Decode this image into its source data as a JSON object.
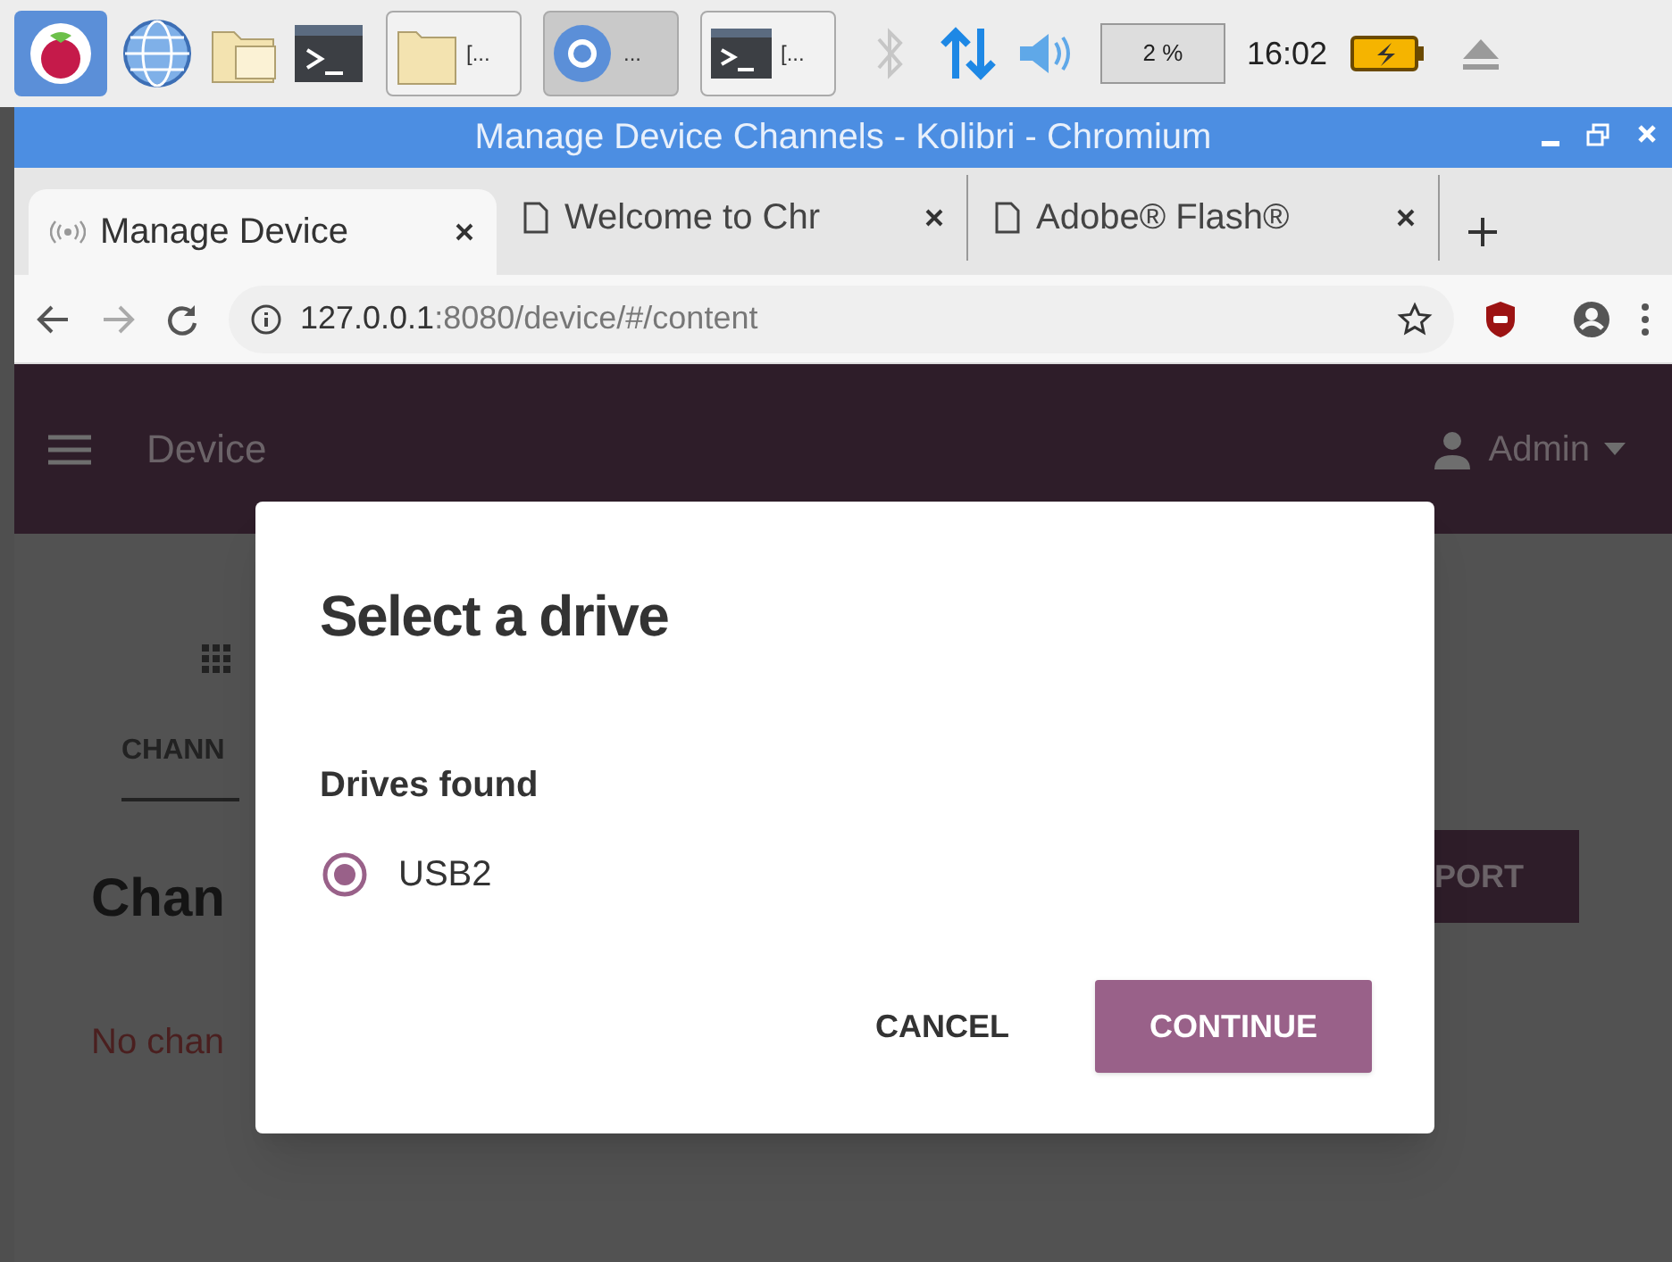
{
  "taskbar": {
    "windows": [
      {
        "kind": "folder",
        "label": "[...",
        "selected": false
      },
      {
        "kind": "browser",
        "label": "...",
        "selected": true
      },
      {
        "kind": "terminal",
        "label": "[...",
        "selected": false
      }
    ],
    "cpu": "2 %",
    "clock": "16:02"
  },
  "window": {
    "title": "Manage Device Channels - Kolibri - Chromium"
  },
  "tabs": [
    {
      "label": "Manage Device",
      "selected": true
    },
    {
      "label": "Welcome to Chr",
      "selected": false
    },
    {
      "label": "Adobe® Flash®",
      "selected": false
    }
  ],
  "address": {
    "host": "127.0.0.1",
    "path": ":8080/device/#/content"
  },
  "app": {
    "title": "Device",
    "user": "Admin",
    "tab": "CHANN",
    "heading": "Chan",
    "button": "PORT",
    "empty": "No chan"
  },
  "dialog": {
    "title": "Select a drive",
    "subtitle": "Drives found",
    "options": [
      {
        "label": "USB2",
        "selected": true
      }
    ],
    "cancel": "CANCEL",
    "confirm": "CONTINUE"
  }
}
